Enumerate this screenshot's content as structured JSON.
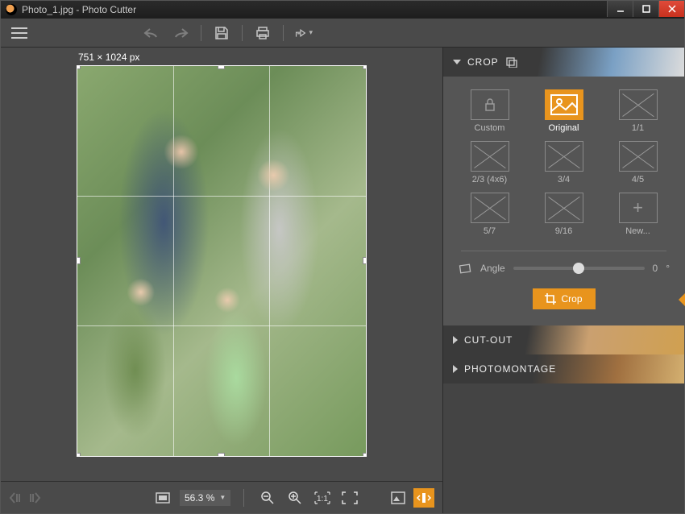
{
  "title": "Photo_1.jpg - Photo Cutter",
  "canvas": {
    "dimensions": "751 × 1024 px"
  },
  "zoom": {
    "percent": "56.3 %"
  },
  "panels": {
    "crop": {
      "label": "CROP",
      "expanded": true
    },
    "cutout": {
      "label": "CUT-OUT",
      "expanded": false
    },
    "photomontage": {
      "label": "PHOTOMONTAGE",
      "expanded": false
    }
  },
  "ratios": [
    {
      "label": "Custom",
      "kind": "lock"
    },
    {
      "label": "Original",
      "kind": "photo",
      "selected": true
    },
    {
      "label": "1/1",
      "kind": "x"
    },
    {
      "label": "2/3 (4x6)",
      "kind": "x"
    },
    {
      "label": "3/4",
      "kind": "x"
    },
    {
      "label": "4/5",
      "kind": "x"
    },
    {
      "label": "5/7",
      "kind": "x"
    },
    {
      "label": "9/16",
      "kind": "x"
    },
    {
      "label": "New...",
      "kind": "plus"
    }
  ],
  "angle": {
    "label": "Angle",
    "value": "0",
    "unit": "°"
  },
  "crop_button": "Crop"
}
